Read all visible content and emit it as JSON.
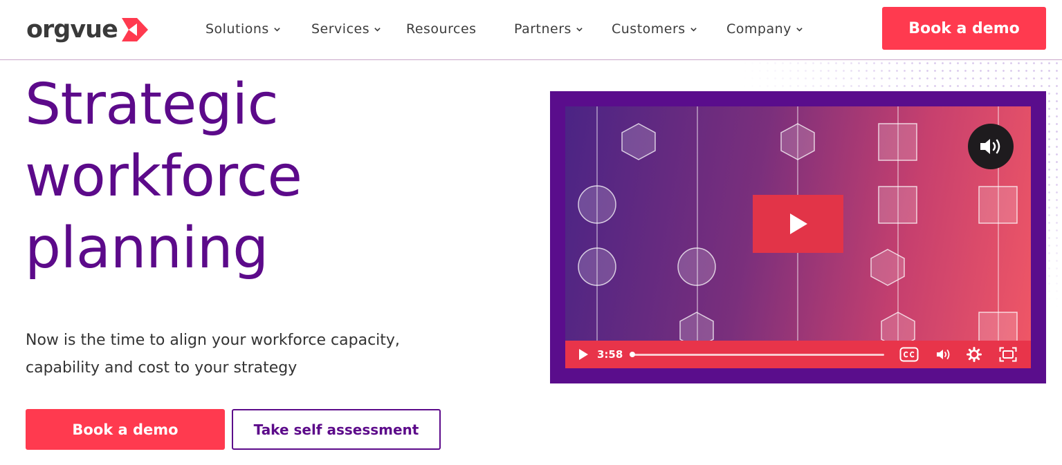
{
  "brand": {
    "logo_text": "orgvue",
    "colors": {
      "purple": "#5c0a8a",
      "red": "#ff3a4f",
      "dark": "#3a3a3a"
    }
  },
  "nav": {
    "items": [
      {
        "label": "Solutions",
        "has_dropdown": true
      },
      {
        "label": "Services",
        "has_dropdown": true
      },
      {
        "label": "Resources",
        "has_dropdown": false
      },
      {
        "label": "Partners",
        "has_dropdown": true
      },
      {
        "label": "Customers",
        "has_dropdown": true
      },
      {
        "label": "Company",
        "has_dropdown": true
      }
    ],
    "cta_label": "Book a demo"
  },
  "hero": {
    "title_lines": [
      "Strategic",
      "workforce",
      "planning"
    ],
    "subtitle_lines": [
      "Now is the time to align your workforce capacity,",
      "capability and cost to your strategy"
    ],
    "primary_cta": "Book a demo",
    "secondary_cta": "Take self assessment"
  },
  "video": {
    "time": "3:58",
    "progress_fraction": 0.0,
    "icons": [
      "play-icon",
      "volume-icon",
      "closed-captions-icon",
      "settings-gear-icon",
      "fullscreen-icon"
    ]
  }
}
